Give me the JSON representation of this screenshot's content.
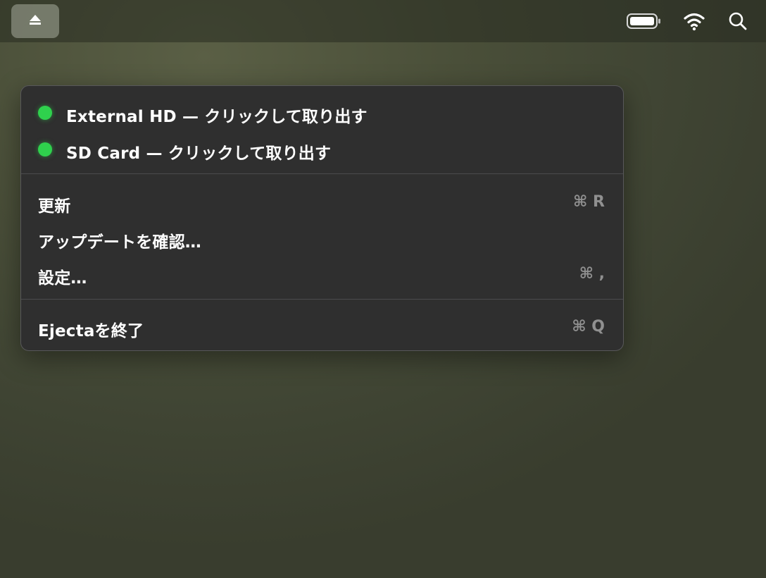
{
  "menubar": {
    "eject_icon": "eject-icon",
    "battery_icon": "battery-icon",
    "wifi_icon": "wifi-icon",
    "search_icon": "search-icon"
  },
  "menu": {
    "drives": [
      {
        "label": "External HD — クリックして取り出す",
        "status_color": "#2fd14d"
      },
      {
        "label": "SD Card — クリックして取り出す",
        "status_color": "#2fd14d"
      }
    ],
    "refresh": {
      "label": "更新",
      "shortcut": "⌘ R"
    },
    "check_updates": {
      "label": "アップデートを確認…"
    },
    "settings": {
      "label": "設定…",
      "shortcut": "⌘ ,"
    },
    "quit": {
      "label": "Ejectaを終了",
      "shortcut": "⌘ Q"
    }
  },
  "colors": {
    "menu_background": "#2f2f2f",
    "status_green": "#2fd14d",
    "shortcut_gray": "#909090"
  }
}
